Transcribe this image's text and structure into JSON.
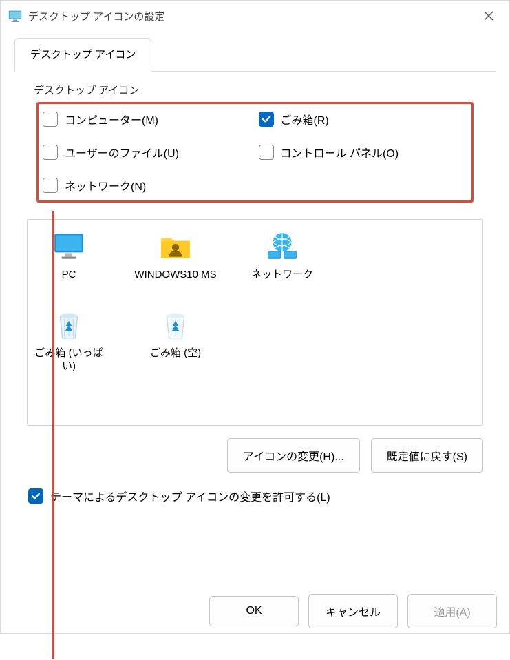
{
  "window": {
    "title": "デスクトップ アイコンの設定"
  },
  "tab": {
    "label": "デスクトップ アイコン"
  },
  "fieldset": {
    "legend": "デスクトップ アイコン"
  },
  "checkboxes": {
    "computer": {
      "label": "コンピューター(M)",
      "checked": false
    },
    "recycle": {
      "label": "ごみ箱(R)",
      "checked": true
    },
    "userfiles": {
      "label": "ユーザーのファイル(U)",
      "checked": false
    },
    "control": {
      "label": "コントロール パネル(O)",
      "checked": false
    },
    "network": {
      "label": "ネットワーク(N)",
      "checked": false
    }
  },
  "icons": {
    "pc": "PC",
    "user": "WINDOWS10 MS",
    "network": "ネットワーク",
    "bin_full": "ごみ箱 (いっぱい)",
    "bin_empty": "ごみ箱 (空)"
  },
  "buttons": {
    "change_icon": "アイコンの変更(H)...",
    "restore_default": "既定値に戻す(S)",
    "ok": "OK",
    "cancel": "キャンセル",
    "apply": "適用(A)"
  },
  "theme_checkbox": {
    "label": "テーマによるデスクトップ アイコンの変更を許可する(L)",
    "checked": true
  }
}
